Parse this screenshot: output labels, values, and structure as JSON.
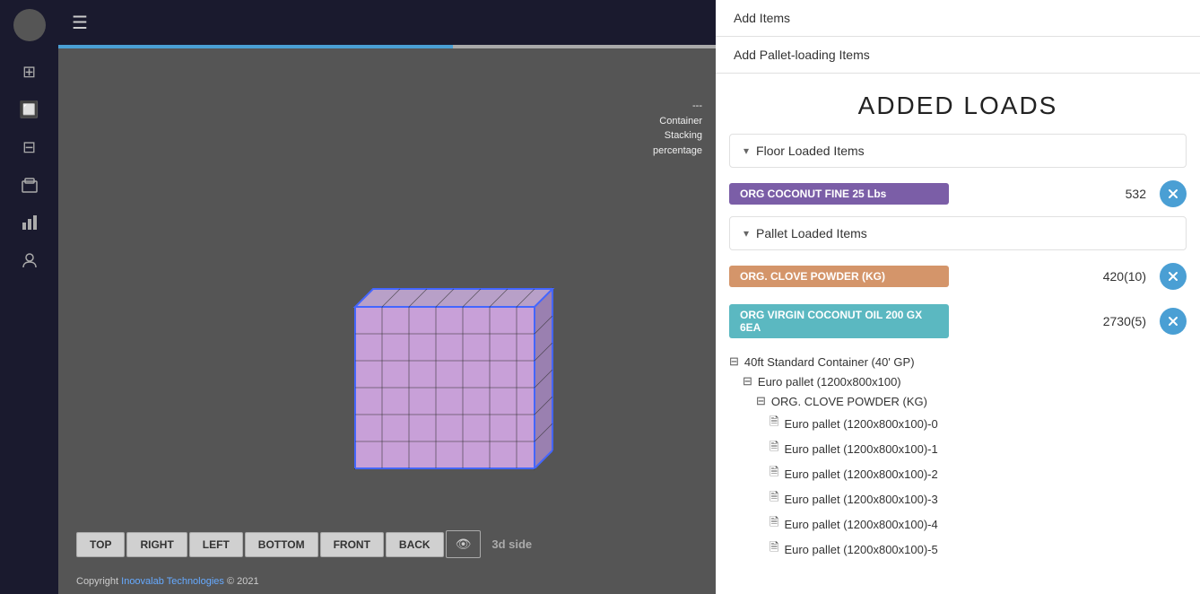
{
  "sidebar": {
    "icons": [
      "☰",
      "⊞",
      "⬛",
      "⊟",
      "📦",
      "📊",
      "👤"
    ]
  },
  "topbar": {
    "hamburger": "☰"
  },
  "viewport": {
    "info_lines": [
      "---",
      "Container",
      "Stacking",
      "percentage"
    ],
    "tabs": [
      "TOP",
      "RIGHT",
      "LEFT",
      "BOTTOM",
      "FRONT",
      "BACK"
    ],
    "tab_3d": "3d side"
  },
  "copyright": {
    "text_prefix": "Copyright ",
    "link_text": "Inoovalab Technologies",
    "text_suffix": " © 2021"
  },
  "right_panel": {
    "menu_items": [
      "Add Items",
      "Add Pallet-loading Items"
    ],
    "added_loads_title": "ADDED LOADS",
    "sections": [
      {
        "label": "Floor Loaded Items",
        "items": [
          {
            "name": "ORG COCONUT FINE 25 Lbs",
            "count": "532",
            "badge_class": "badge-purple"
          }
        ]
      },
      {
        "label": "Pallet Loaded Items",
        "items": [
          {
            "name": "ORG. CLOVE POWDER (KG)",
            "count": "420(10)",
            "badge_class": "badge-orange"
          },
          {
            "name": "ORG VIRGIN COCONUT OIL 200 GX 6EA",
            "count": "2730(5)",
            "badge_class": "badge-teal"
          }
        ]
      }
    ],
    "tree": {
      "root": "40ft Standard Container (40' GP)",
      "children": [
        {
          "label": "Euro pallet (1200x800x100)",
          "children": [
            {
              "label": "ORG. CLOVE POWDER (KG)",
              "children": [
                "Euro pallet (1200x800x100)-0",
                "Euro pallet (1200x800x100)-1",
                "Euro pallet (1200x800x100)-2",
                "Euro pallet (1200x800x100)-3",
                "Euro pallet (1200x800x100)-4",
                "Euro pallet (1200x800x100)-5"
              ]
            }
          ]
        }
      ]
    }
  }
}
